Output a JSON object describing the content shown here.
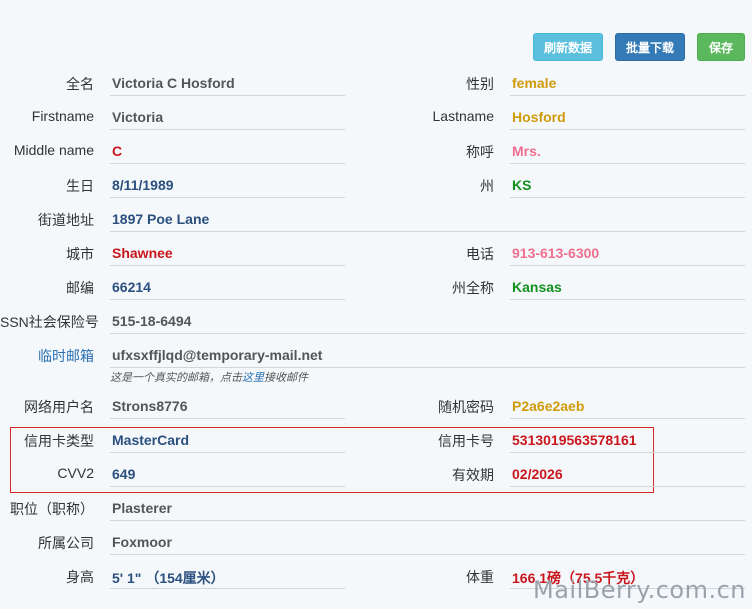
{
  "toolbar": {
    "refresh_label": "刷新数据",
    "download_label": "批量下载",
    "save_label": "保存"
  },
  "fields": {
    "fullname": {
      "label": "全名",
      "value": "Victoria C Hosford"
    },
    "gender": {
      "label": "性别",
      "value": "female"
    },
    "firstname": {
      "label": "Firstname",
      "value": "Victoria"
    },
    "lastname": {
      "label": "Lastname",
      "value": "Hosford"
    },
    "middlename": {
      "label": "Middle name",
      "value": "C"
    },
    "title": {
      "label": "称呼",
      "value": "Mrs."
    },
    "birthday": {
      "label": "生日",
      "value": "8/11/1989"
    },
    "state": {
      "label": "州",
      "value": "KS"
    },
    "street": {
      "label": "街道地址",
      "value": "1897 Poe Lane"
    },
    "city": {
      "label": "城市",
      "value": "Shawnee"
    },
    "phone": {
      "label": "电话",
      "value": "913-613-6300"
    },
    "zip": {
      "label": "邮编",
      "value": "66214"
    },
    "state_full": {
      "label": "州全称",
      "value": "Kansas"
    },
    "ssn": {
      "label": "SSN社会保险号",
      "value": "515-18-6494"
    },
    "temp_email": {
      "label": "临时邮箱",
      "value": "ufxsxffjlqd@temporary-mail.net"
    },
    "username": {
      "label": "网络用户名",
      "value": "Strons8776"
    },
    "password": {
      "label": "随机密码",
      "value": "P2a6e2aeb"
    },
    "card_type": {
      "label": "信用卡类型",
      "value": "MasterCard"
    },
    "card_number": {
      "label": "信用卡号",
      "value": "5313019563578161"
    },
    "cvv2": {
      "label": "CVV2",
      "value": "649"
    },
    "expiry": {
      "label": "有效期",
      "value": "02/2026"
    },
    "job": {
      "label": "职位（职称）",
      "value": "Plasterer"
    },
    "company": {
      "label": "所属公司",
      "value": "Foxmoor"
    },
    "height": {
      "label": "身高",
      "value": "5' 1\" （154厘米）"
    },
    "weight": {
      "label": "体重",
      "value": "166.1磅（75.5千克）"
    }
  },
  "email_note": {
    "before": "这是一个真实的邮箱，点击",
    "link": "这里",
    "after": "接收邮件"
  },
  "watermark": "MailBerry.com.cn",
  "colors": {
    "refresh": "#5bc0de",
    "download": "#337ab7",
    "save": "#5cb85c",
    "highlight_box": "#d32b2b"
  }
}
